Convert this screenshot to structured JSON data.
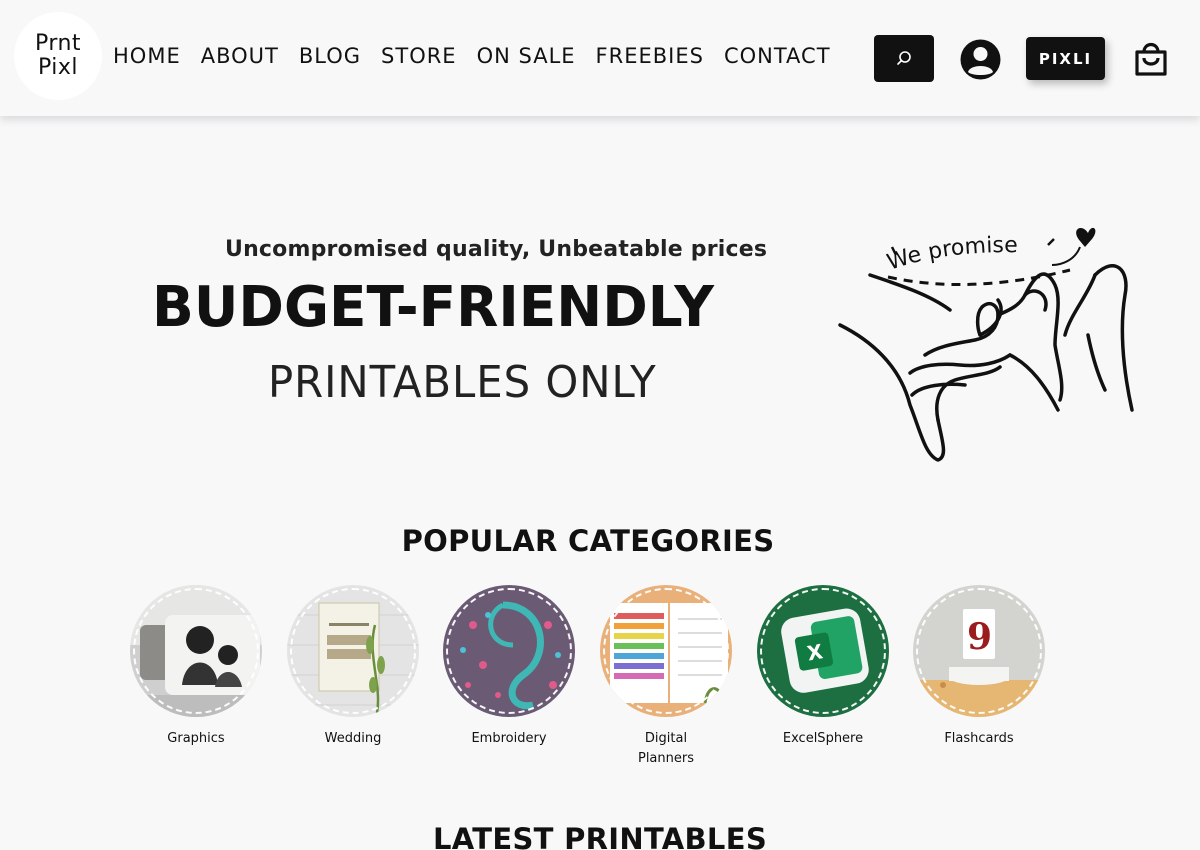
{
  "logo": {
    "line1": "Prnt",
    "line2": "Pixl"
  },
  "nav": [
    "HOME",
    "ABOUT",
    "BLOG",
    "STORE",
    "ON SALE",
    "FREEBIES",
    "CONTACT"
  ],
  "header": {
    "search_icon": "search-icon",
    "user_icon": "user-account-icon",
    "pixli_label": "PIXLI",
    "cart_icon": "shopping-bag-icon"
  },
  "banner": {
    "tagline": "Uncompromised quality, Unbeatable prices",
    "headline": "BUDGET-FRIENDLY",
    "subline": "PRINTABLES ONLY",
    "promise": "We promise"
  },
  "popular": {
    "title": "POPULAR CATEGORIES",
    "categories": [
      {
        "label": "Graphics"
      },
      {
        "label": "Wedding"
      },
      {
        "label": "Embroidery"
      },
      {
        "label": "Digital Planners"
      },
      {
        "label": "ExcelSphere"
      },
      {
        "label": "Flashcards"
      }
    ]
  },
  "latest": {
    "title": "LATEST PRINTABLES"
  },
  "colors": {
    "accent": "#111111",
    "background": "#f8f8f9",
    "excel_green": "#1d6f42"
  }
}
